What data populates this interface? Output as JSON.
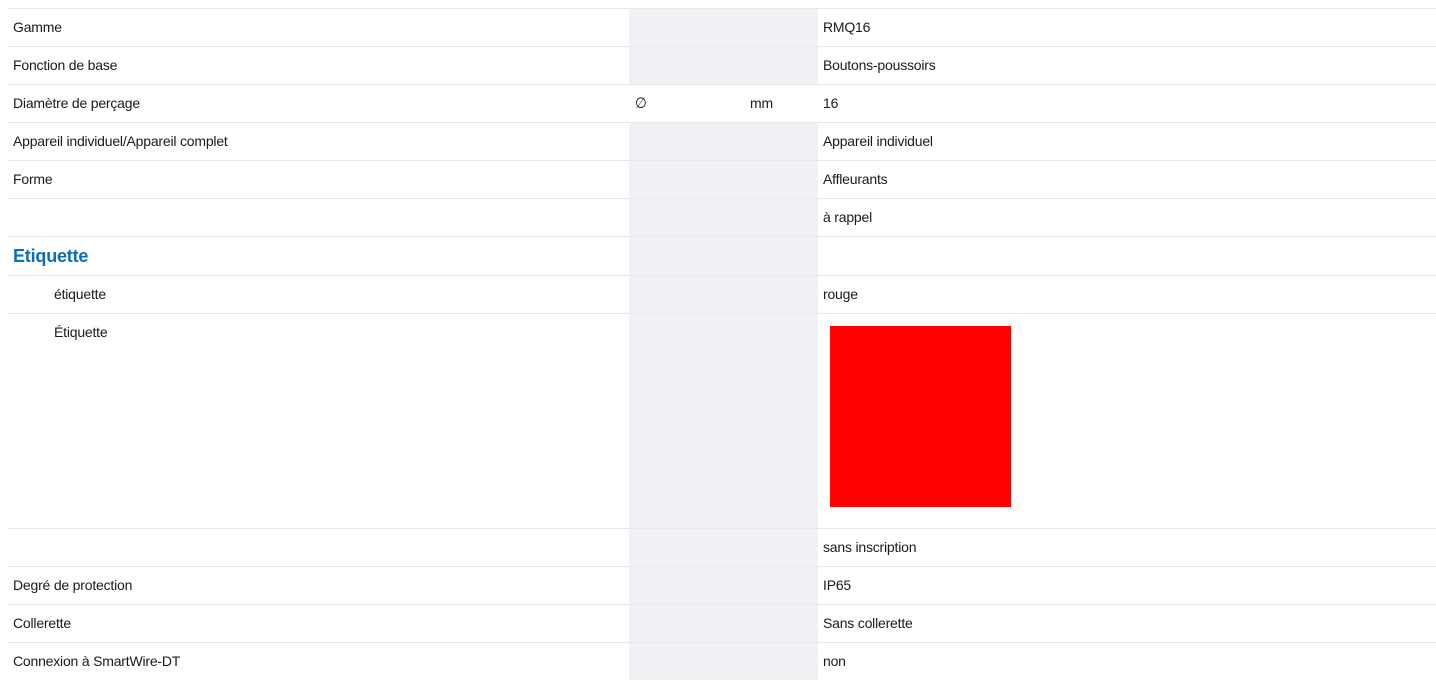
{
  "rows_top": [
    {
      "label": "Gamme",
      "symbol": "",
      "unit": "",
      "value": "RMQ16"
    },
    {
      "label": "Fonction de base",
      "symbol": "",
      "unit": "",
      "value": "Boutons-poussoirs"
    },
    {
      "label": "Diamètre de perçage",
      "symbol": "∅",
      "unit": "mm",
      "value": "16"
    },
    {
      "label": "Appareil individuel/Appareil complet",
      "symbol": "",
      "unit": "",
      "value": "Appareil individuel"
    },
    {
      "label": "Forme",
      "symbol": "",
      "unit": "",
      "value": "Affleurants"
    },
    {
      "label": "",
      "symbol": "",
      "unit": "",
      "value": "à rappel"
    }
  ],
  "section": {
    "heading": "Etiquette",
    "label_row": {
      "label": "étiquette",
      "value": "rouge"
    },
    "image_row": {
      "label": "Étiquette",
      "swatch_color": "#ff0000"
    },
    "inscription_row": {
      "label": "",
      "value": "sans inscription"
    }
  },
  "rows_bottom": [
    {
      "label": "Degré de protection",
      "symbol": "",
      "unit": "",
      "value": "IP65"
    },
    {
      "label": "Collerette",
      "symbol": "",
      "unit": "",
      "value": "Sans collerette"
    },
    {
      "label": "Connexion à SmartWire-DT",
      "symbol": "",
      "unit": "",
      "value": "non"
    }
  ]
}
